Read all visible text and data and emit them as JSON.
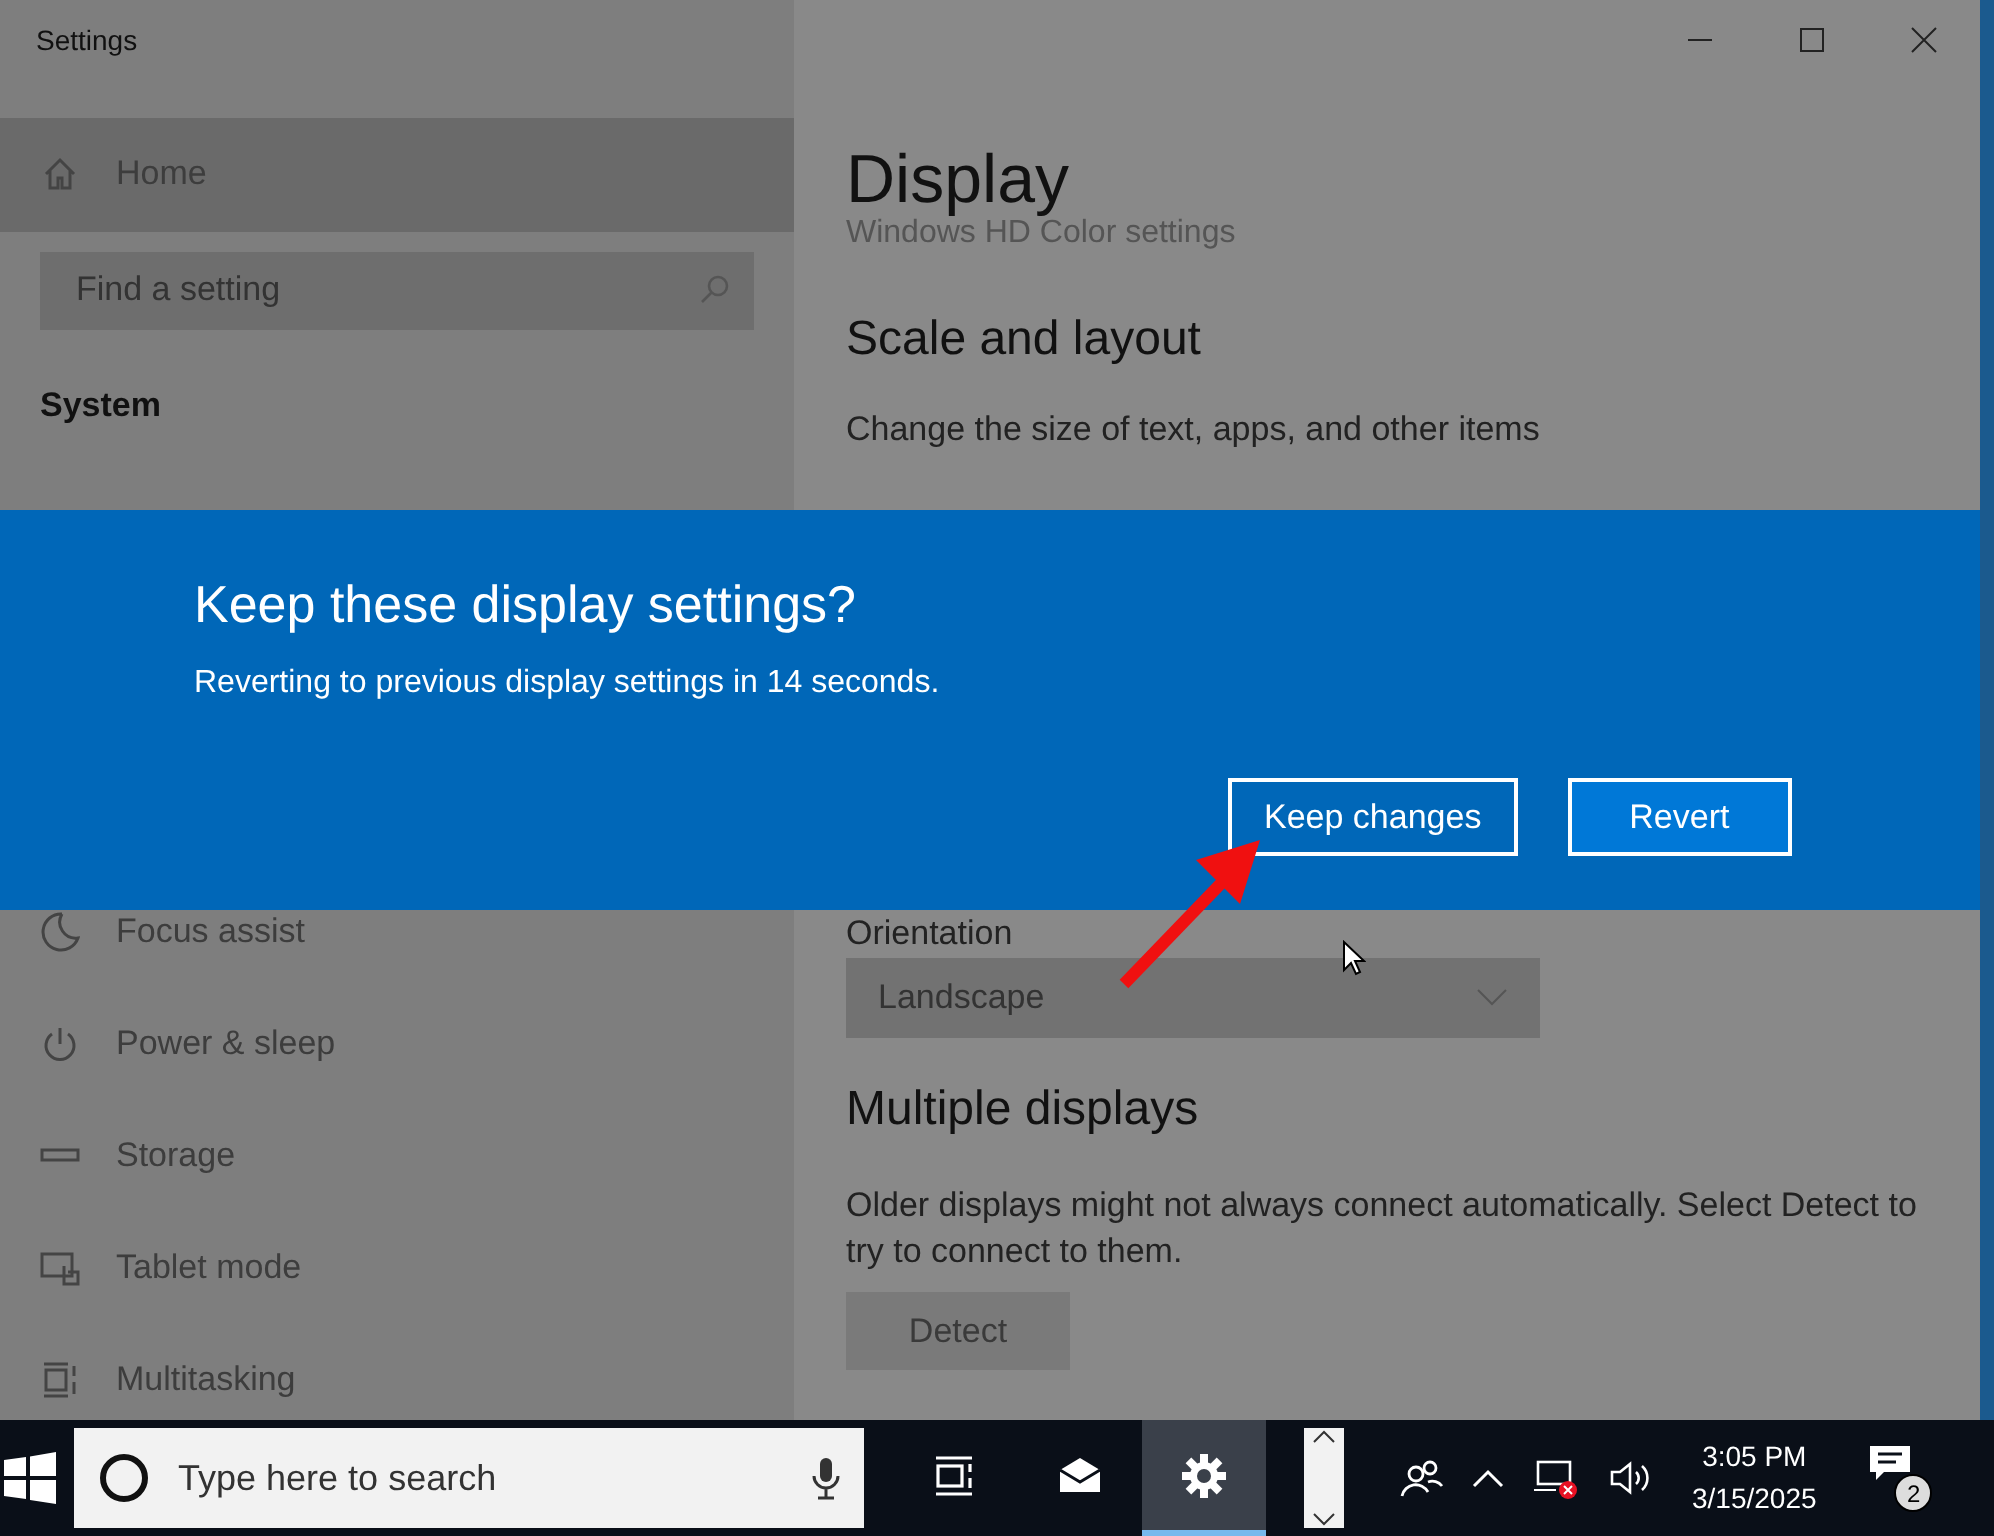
{
  "window": {
    "title": "Settings"
  },
  "sidebar": {
    "items": [
      {
        "label": "Home",
        "highlighted": true
      }
    ],
    "search": {
      "placeholder": "Find a setting"
    },
    "section": "System",
    "nav": [
      {
        "label": "Focus assist"
      },
      {
        "label": "Power & sleep"
      },
      {
        "label": "Storage"
      },
      {
        "label": "Tablet mode"
      },
      {
        "label": "Multitasking"
      }
    ]
  },
  "content": {
    "title": "Display",
    "link": "Windows HD Color settings",
    "scale_heading": "Scale and layout",
    "scale_label": "Change the size of text, apps, and other items",
    "orientation_label": "Orientation",
    "orientation_value": "Landscape",
    "multi_heading": "Multiple displays",
    "multi_text": "Older displays might not always connect automatically. Select Detect to try to connect to them.",
    "detect_button": "Detect"
  },
  "dialog": {
    "title": "Keep these display settings?",
    "message": "Reverting to previous display settings in 14 seconds.",
    "buttons": [
      {
        "label": "Keep changes",
        "primary": false
      },
      {
        "label": "Revert",
        "primary": true
      }
    ]
  },
  "taskbar": {
    "search_placeholder": "Type here to search",
    "apps": [
      {
        "active": false
      },
      {
        "active": false
      },
      {
        "active": true
      }
    ],
    "time": "3:05 PM",
    "date": "3/15/2025",
    "notification_count": "2"
  }
}
